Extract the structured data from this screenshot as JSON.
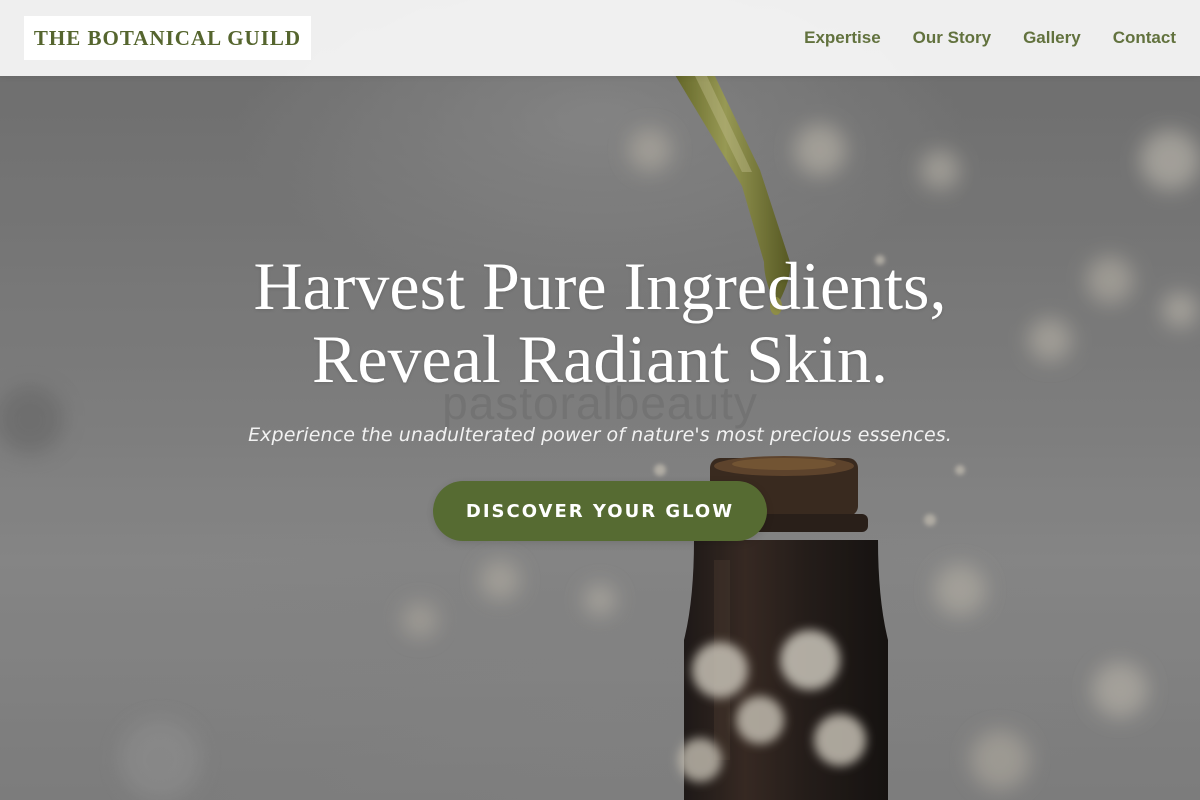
{
  "header": {
    "logo_text": "THE BOTANICAL GUILD",
    "nav": [
      "Expertise",
      "Our Story",
      "Gallery",
      "Contact"
    ]
  },
  "hero": {
    "headline_line1": "Harvest Pure Ingredients,",
    "headline_line2": "Reveal Radiant Skin.",
    "ghost_text": "pastoralbeauty",
    "subtitle": "Experience the unadulterated power of nature's most precious essences.",
    "cta_label": "DISCOVER YOUR GLOW",
    "image_description": "dropper-over-amber-bottle-with-baby-breath-flowers"
  },
  "colors": {
    "brand_green": "#566b32",
    "header_bg": "#f4f4f4",
    "text_light": "#ffffff"
  }
}
